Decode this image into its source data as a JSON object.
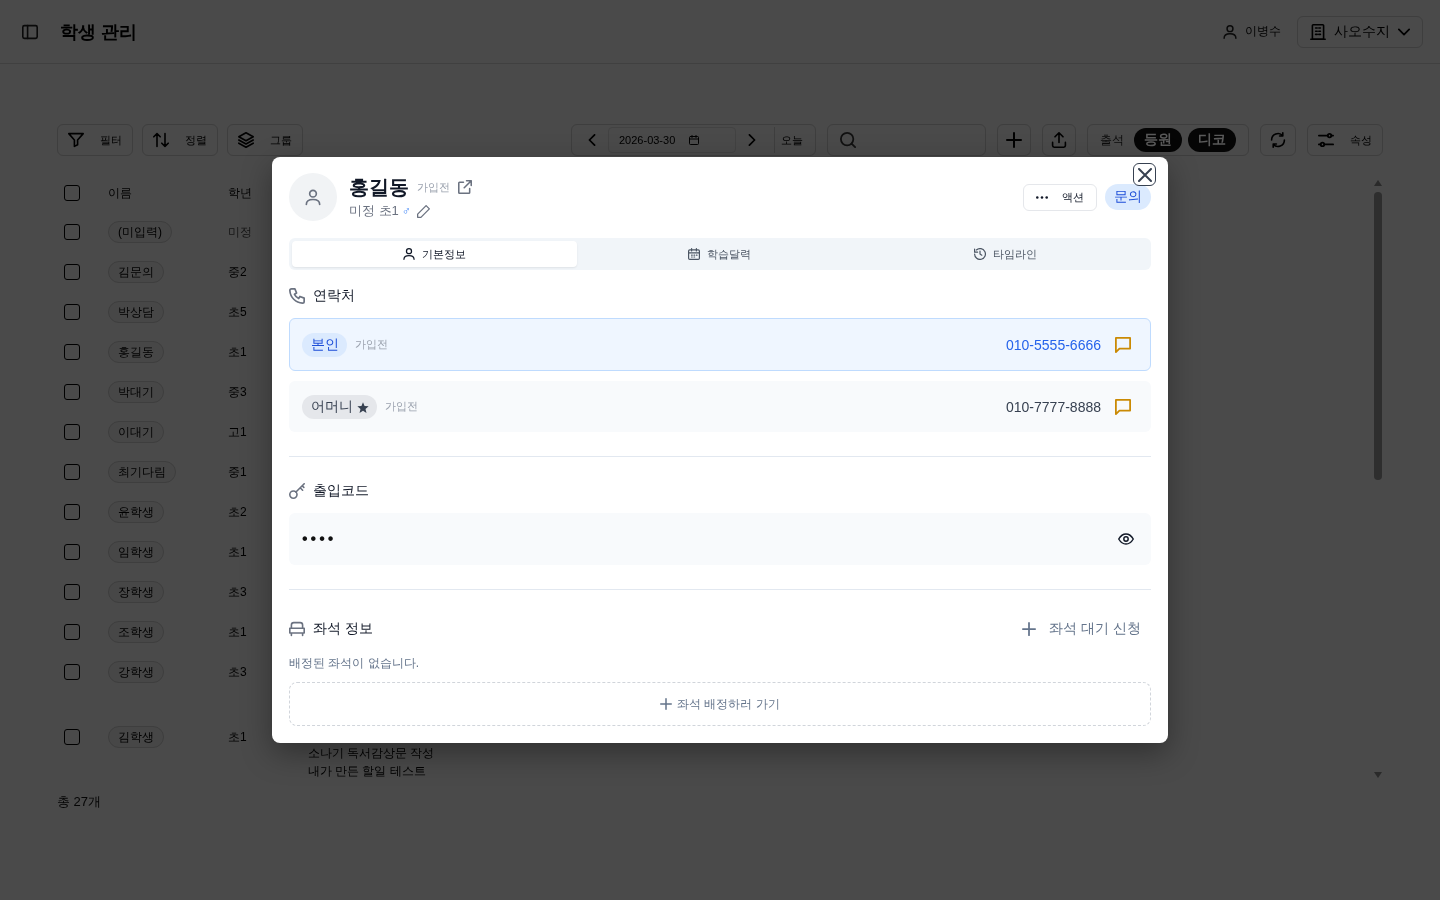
{
  "header": {
    "title": "학생 관리",
    "user": "이병수",
    "organization": "사오수지"
  },
  "toolbar": {
    "tools": [
      {
        "kind": "filter",
        "label": "필터"
      },
      {
        "kind": "sort",
        "label": "정렬"
      },
      {
        "kind": "group",
        "label": "그룹"
      }
    ],
    "date": "2026-03-30",
    "today": "오늘",
    "toggles": [
      {
        "label": "출석",
        "on": false
      },
      {
        "label": "등원",
        "on": true
      },
      {
        "label": "디코",
        "on": true
      }
    ],
    "properties": "속성"
  },
  "table": {
    "all_checked": false,
    "columns": [
      "이름",
      "학년"
    ],
    "rows": [
      {
        "name": "(미입력)",
        "grade": "미정",
        "grade_set": false,
        "checked": false
      },
      {
        "name": "김문의",
        "grade": "중2",
        "grade_set": true,
        "checked": false
      },
      {
        "name": "박상담",
        "grade": "초5",
        "grade_set": true,
        "checked": false
      },
      {
        "name": "홍길동",
        "grade": "초1",
        "grade_set": true,
        "checked": false
      },
      {
        "name": "박대기",
        "grade": "중3",
        "grade_set": true,
        "checked": false
      },
      {
        "name": "이대기",
        "grade": "고1",
        "grade_set": true,
        "checked": false
      },
      {
        "name": "최기다림",
        "grade": "중1",
        "grade_set": true,
        "checked": false
      },
      {
        "name": "윤학생",
        "grade": "초2",
        "grade_set": true,
        "checked": false
      },
      {
        "name": "임학생",
        "grade": "초1",
        "grade_set": true,
        "checked": false
      },
      {
        "name": "장학생",
        "grade": "초3",
        "grade_set": true,
        "checked": false
      },
      {
        "name": "조학생",
        "grade": "초1",
        "grade_set": true,
        "checked": false
      },
      {
        "name": "강학생",
        "grade": "초3",
        "grade_set": true,
        "checked": false
      },
      {
        "name": "김학생",
        "grade": "초1",
        "grade_set": true,
        "checked": false,
        "column_3": [
          "소나기 독서감상문 작성",
          "내가 만든 할일 테스트"
        ]
      }
    ]
  },
  "total": "총 27개",
  "modal": {
    "name": "홍길동",
    "status": "가입전",
    "subtitle": "미정 초1",
    "gender": "♂",
    "action": "액션",
    "badge": "문의",
    "tabs": [
      {
        "kind": "profile",
        "label": "기본정보",
        "selected": true
      },
      {
        "kind": "calendar",
        "label": "학습달력",
        "selected": false
      },
      {
        "kind": "timeline",
        "label": "타임라인",
        "selected": false
      }
    ],
    "contacts": {
      "title": "연락처",
      "items": [
        {
          "kind": "self",
          "relation": "본인",
          "status": "가입전",
          "phone": "010-5555-6666",
          "primary": false
        },
        {
          "kind": "guardian",
          "relation": "어머니",
          "status": "가입전",
          "phone": "010-7777-8888",
          "primary": true
        }
      ]
    },
    "access_code": {
      "title": "출입코드",
      "value": "••••"
    },
    "seat": {
      "title": "좌석 정보",
      "waitlist": "좌석 대기 신청",
      "empty_message": "배정된 좌석이 없습니다.",
      "assign": "좌석 배정하러 가기"
    }
  }
}
